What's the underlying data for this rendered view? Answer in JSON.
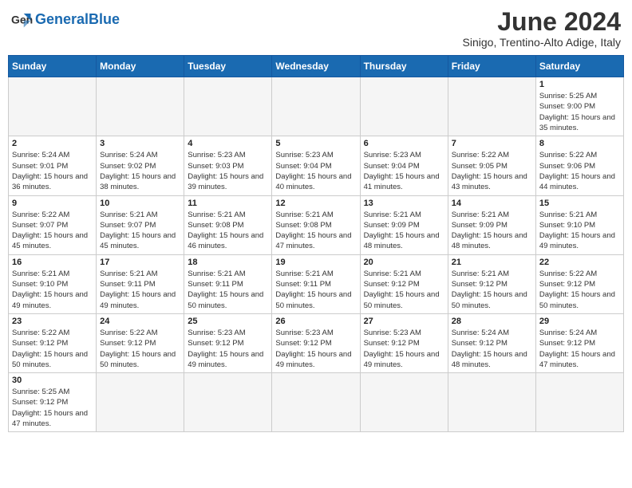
{
  "header": {
    "logo_general": "General",
    "logo_blue": "Blue",
    "title": "June 2024",
    "subtitle": "Sinigo, Trentino-Alto Adige, Italy"
  },
  "weekdays": [
    "Sunday",
    "Monday",
    "Tuesday",
    "Wednesday",
    "Thursday",
    "Friday",
    "Saturday"
  ],
  "weeks": [
    [
      {
        "day": "",
        "info": "",
        "empty": true
      },
      {
        "day": "",
        "info": "",
        "empty": true
      },
      {
        "day": "",
        "info": "",
        "empty": true
      },
      {
        "day": "",
        "info": "",
        "empty": true
      },
      {
        "day": "",
        "info": "",
        "empty": true
      },
      {
        "day": "",
        "info": "",
        "empty": true
      },
      {
        "day": "1",
        "info": "Sunrise: 5:25 AM\nSunset: 9:00 PM\nDaylight: 15 hours and 35 minutes."
      }
    ],
    [
      {
        "day": "2",
        "info": "Sunrise: 5:24 AM\nSunset: 9:01 PM\nDaylight: 15 hours and 36 minutes."
      },
      {
        "day": "3",
        "info": "Sunrise: 5:24 AM\nSunset: 9:02 PM\nDaylight: 15 hours and 38 minutes."
      },
      {
        "day": "4",
        "info": "Sunrise: 5:23 AM\nSunset: 9:03 PM\nDaylight: 15 hours and 39 minutes."
      },
      {
        "day": "5",
        "info": "Sunrise: 5:23 AM\nSunset: 9:04 PM\nDaylight: 15 hours and 40 minutes."
      },
      {
        "day": "6",
        "info": "Sunrise: 5:23 AM\nSunset: 9:04 PM\nDaylight: 15 hours and 41 minutes."
      },
      {
        "day": "7",
        "info": "Sunrise: 5:22 AM\nSunset: 9:05 PM\nDaylight: 15 hours and 43 minutes."
      },
      {
        "day": "8",
        "info": "Sunrise: 5:22 AM\nSunset: 9:06 PM\nDaylight: 15 hours and 44 minutes."
      }
    ],
    [
      {
        "day": "9",
        "info": "Sunrise: 5:22 AM\nSunset: 9:07 PM\nDaylight: 15 hours and 45 minutes."
      },
      {
        "day": "10",
        "info": "Sunrise: 5:21 AM\nSunset: 9:07 PM\nDaylight: 15 hours and 45 minutes."
      },
      {
        "day": "11",
        "info": "Sunrise: 5:21 AM\nSunset: 9:08 PM\nDaylight: 15 hours and 46 minutes."
      },
      {
        "day": "12",
        "info": "Sunrise: 5:21 AM\nSunset: 9:08 PM\nDaylight: 15 hours and 47 minutes."
      },
      {
        "day": "13",
        "info": "Sunrise: 5:21 AM\nSunset: 9:09 PM\nDaylight: 15 hours and 48 minutes."
      },
      {
        "day": "14",
        "info": "Sunrise: 5:21 AM\nSunset: 9:09 PM\nDaylight: 15 hours and 48 minutes."
      },
      {
        "day": "15",
        "info": "Sunrise: 5:21 AM\nSunset: 9:10 PM\nDaylight: 15 hours and 49 minutes."
      }
    ],
    [
      {
        "day": "16",
        "info": "Sunrise: 5:21 AM\nSunset: 9:10 PM\nDaylight: 15 hours and 49 minutes."
      },
      {
        "day": "17",
        "info": "Sunrise: 5:21 AM\nSunset: 9:11 PM\nDaylight: 15 hours and 49 minutes."
      },
      {
        "day": "18",
        "info": "Sunrise: 5:21 AM\nSunset: 9:11 PM\nDaylight: 15 hours and 50 minutes."
      },
      {
        "day": "19",
        "info": "Sunrise: 5:21 AM\nSunset: 9:11 PM\nDaylight: 15 hours and 50 minutes."
      },
      {
        "day": "20",
        "info": "Sunrise: 5:21 AM\nSunset: 9:12 PM\nDaylight: 15 hours and 50 minutes."
      },
      {
        "day": "21",
        "info": "Sunrise: 5:21 AM\nSunset: 9:12 PM\nDaylight: 15 hours and 50 minutes."
      },
      {
        "day": "22",
        "info": "Sunrise: 5:22 AM\nSunset: 9:12 PM\nDaylight: 15 hours and 50 minutes."
      }
    ],
    [
      {
        "day": "23",
        "info": "Sunrise: 5:22 AM\nSunset: 9:12 PM\nDaylight: 15 hours and 50 minutes."
      },
      {
        "day": "24",
        "info": "Sunrise: 5:22 AM\nSunset: 9:12 PM\nDaylight: 15 hours and 50 minutes."
      },
      {
        "day": "25",
        "info": "Sunrise: 5:23 AM\nSunset: 9:12 PM\nDaylight: 15 hours and 49 minutes."
      },
      {
        "day": "26",
        "info": "Sunrise: 5:23 AM\nSunset: 9:12 PM\nDaylight: 15 hours and 49 minutes."
      },
      {
        "day": "27",
        "info": "Sunrise: 5:23 AM\nSunset: 9:12 PM\nDaylight: 15 hours and 49 minutes."
      },
      {
        "day": "28",
        "info": "Sunrise: 5:24 AM\nSunset: 9:12 PM\nDaylight: 15 hours and 48 minutes."
      },
      {
        "day": "29",
        "info": "Sunrise: 5:24 AM\nSunset: 9:12 PM\nDaylight: 15 hours and 47 minutes."
      }
    ],
    [
      {
        "day": "30",
        "info": "Sunrise: 5:25 AM\nSunset: 9:12 PM\nDaylight: 15 hours and 47 minutes."
      },
      {
        "day": "",
        "info": "",
        "empty": true
      },
      {
        "day": "",
        "info": "",
        "empty": true
      },
      {
        "day": "",
        "info": "",
        "empty": true
      },
      {
        "day": "",
        "info": "",
        "empty": true
      },
      {
        "day": "",
        "info": "",
        "empty": true
      },
      {
        "day": "",
        "info": "",
        "empty": true
      }
    ]
  ]
}
